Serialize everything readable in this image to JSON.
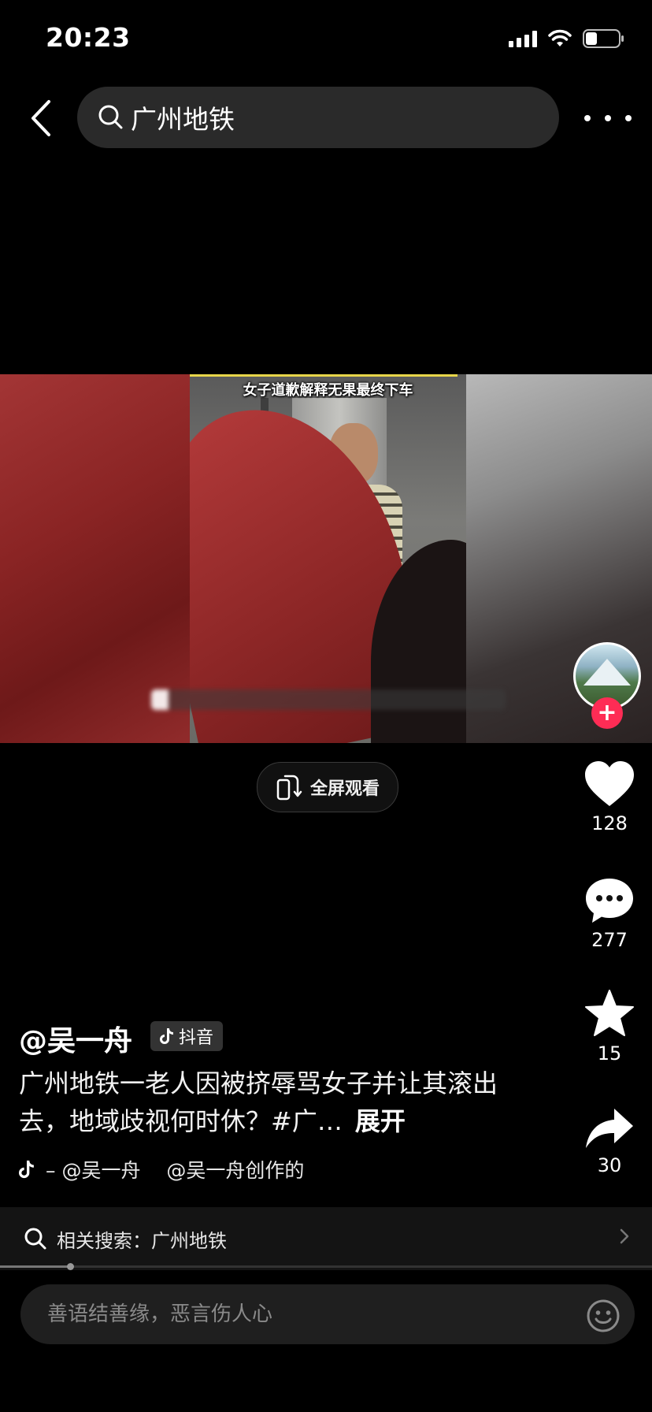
{
  "status_bar": {
    "time": "20:23"
  },
  "search": {
    "query": "广州地铁"
  },
  "video": {
    "caption": "女子道歉解释无果最终下车"
  },
  "fullscreen": {
    "label": "全屏观看"
  },
  "actions": {
    "likes": "128",
    "comments": "277",
    "favorites": "15",
    "shares": "30"
  },
  "post": {
    "author": "@吴一舟",
    "platform_badge": "抖音",
    "description": "广州地铁一老人因被挤辱骂女子并让其滚出去，地域歧视何时休？#广…",
    "expand_label": "展开",
    "music": "– @吴一舟　 @吴一舟创作的"
  },
  "related": {
    "text": "相关搜索：广州地铁"
  },
  "comment": {
    "placeholder": "善语结善缘，恶言伤人心"
  },
  "colors": {
    "accent": "#fe2c55",
    "background": "#000000"
  }
}
